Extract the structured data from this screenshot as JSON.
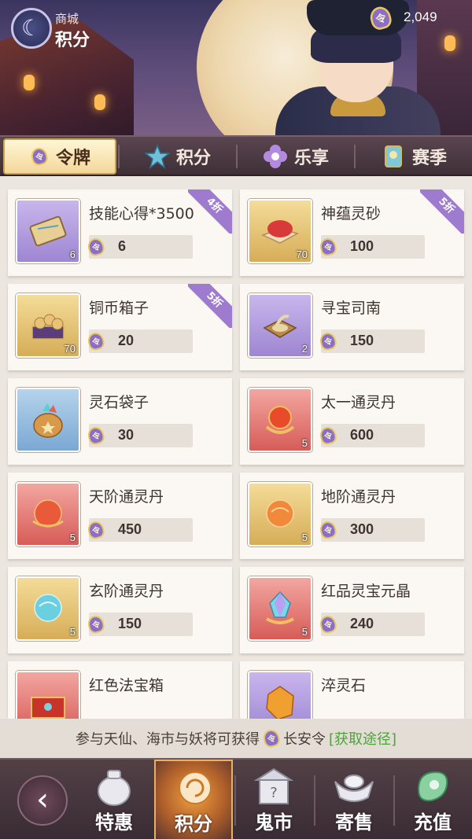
{
  "header": {
    "subtitle": "商城",
    "title": "积分",
    "currency_value": "2,049"
  },
  "tabs": [
    {
      "label": "令牌",
      "icon": "token-icon",
      "active": true
    },
    {
      "label": "积分",
      "icon": "star-icon",
      "active": false
    },
    {
      "label": "乐享",
      "icon": "flower-icon",
      "active": false
    },
    {
      "label": "赛季",
      "icon": "season-card-icon",
      "active": false
    }
  ],
  "items": [
    {
      "name": "技能心得*3500",
      "price": "6",
      "qty": "6",
      "frame": "purple",
      "discount": "4折",
      "icon": "scroll-map-icon"
    },
    {
      "name": "神蕴灵砂",
      "price": "100",
      "qty": "70",
      "frame": "gold",
      "discount": "5折",
      "icon": "red-sand-icon"
    },
    {
      "name": "铜币箱子",
      "price": "20",
      "qty": "70",
      "frame": "gold",
      "discount": "5折",
      "icon": "coin-chest-icon"
    },
    {
      "name": "寻宝司南",
      "price": "150",
      "qty": "2",
      "frame": "purple",
      "discount": "",
      "icon": "compass-icon"
    },
    {
      "name": "灵石袋子",
      "price": "30",
      "qty": "",
      "frame": "blue",
      "discount": "",
      "icon": "gem-bag-icon"
    },
    {
      "name": "太一通灵丹",
      "price": "600",
      "qty": "5",
      "frame": "red",
      "discount": "",
      "icon": "red-pill-icon"
    },
    {
      "name": "天阶通灵丹",
      "price": "450",
      "qty": "5",
      "frame": "red",
      "discount": "",
      "icon": "orb-red-icon"
    },
    {
      "name": "地阶通灵丹",
      "price": "300",
      "qty": "5",
      "frame": "gold",
      "discount": "",
      "icon": "orb-orange-icon"
    },
    {
      "name": "玄阶通灵丹",
      "price": "150",
      "qty": "5",
      "frame": "gold",
      "discount": "",
      "icon": "orb-blue-icon"
    },
    {
      "name": "红品灵宝元晶",
      "price": "240",
      "qty": "5",
      "frame": "red",
      "discount": "",
      "icon": "crystal-icon"
    },
    {
      "name": "红色法宝箱",
      "price": "",
      "qty": "",
      "frame": "red",
      "discount": "",
      "icon": "red-chest-icon"
    },
    {
      "name": "淬灵石",
      "price": "",
      "qty": "",
      "frame": "purple",
      "discount": "",
      "icon": "amber-stone-icon"
    }
  ],
  "info": {
    "text_before": "参与天仙、海市与妖将可获得",
    "currency_name": "长安令",
    "link": "[获取途径]"
  },
  "bottom_nav": [
    {
      "label": "特惠",
      "icon": "money-bag-icon",
      "active": false
    },
    {
      "label": "积分",
      "icon": "swirl-icon",
      "active": true
    },
    {
      "label": "鬼市",
      "icon": "ghost-market-icon",
      "active": false
    },
    {
      "label": "寄售",
      "icon": "gold-ingot-icon",
      "active": false
    },
    {
      "label": "充值",
      "icon": "jade-icon",
      "active": false
    }
  ],
  "colors": {
    "discount_ribbon": "#9f7bd0",
    "acquire_link": "#4da33c",
    "active_tab_bg": "#f3d79a"
  }
}
